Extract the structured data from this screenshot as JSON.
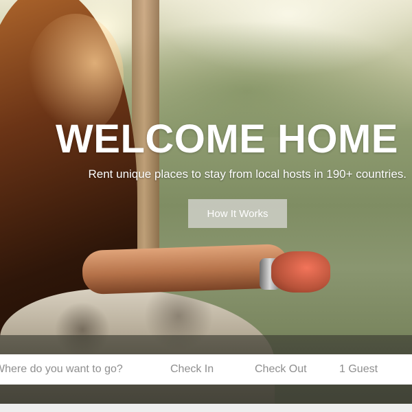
{
  "hero": {
    "headline": "WELCOME HOME",
    "subheadline": "Rent unique places to stay from local hosts in 190+ countries.",
    "cta_label": "How It Works"
  },
  "search": {
    "where_placeholder": "Where do you want to go?",
    "checkin_label": "Check In",
    "checkout_label": "Check Out",
    "guests_label": "1 Guest"
  },
  "colors": {
    "text_on_hero": "#ffffff",
    "search_text": "#8e8e8e",
    "button_bg": "#d2d2cc"
  }
}
